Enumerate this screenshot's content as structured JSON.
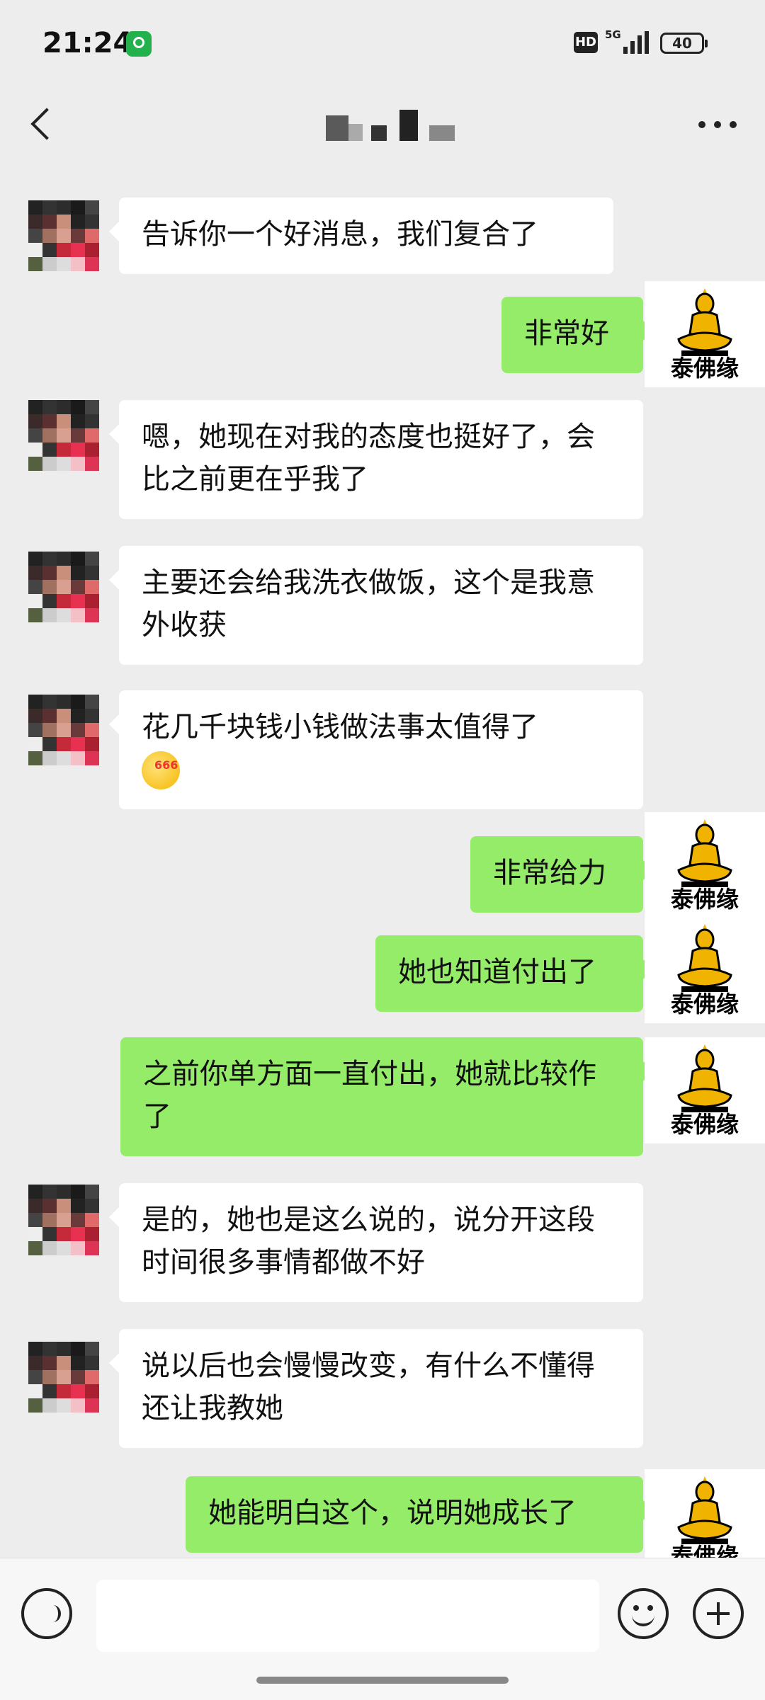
{
  "status_bar": {
    "time": "21:24",
    "hd": "HD",
    "network": "5G",
    "battery": "40"
  },
  "header": {
    "title_redacted": true
  },
  "messages": [
    {
      "side": "in",
      "text": "告诉你一个好消息，我们复合了"
    },
    {
      "side": "out",
      "text": "非常好"
    },
    {
      "side": "in",
      "text": "嗯，她现在对我的态度也挺好了，会比之前更在乎我了"
    },
    {
      "side": "in",
      "text": "主要还会给我洗衣做饭，这个是我意外收获"
    },
    {
      "side": "in",
      "text": "花几千块钱小钱做法事太值得了",
      "emoji": "666"
    },
    {
      "side": "out",
      "text": "非常给力"
    },
    {
      "side": "out",
      "text": "她也知道付出了"
    },
    {
      "side": "out",
      "text": "之前你单方面一直付出，她就比较作了"
    },
    {
      "side": "in",
      "text": "是的，她也是这么说的，说分开这段时间很多事情都做不好"
    },
    {
      "side": "in",
      "text": "说以后也会慢慢改变，有什么不懂得还让我教她"
    },
    {
      "side": "out",
      "text": "她能明白这个，说明她成长了"
    }
  ],
  "sticker": {
    "text": "泰佛缘"
  },
  "input_bar": {
    "placeholder": ""
  }
}
